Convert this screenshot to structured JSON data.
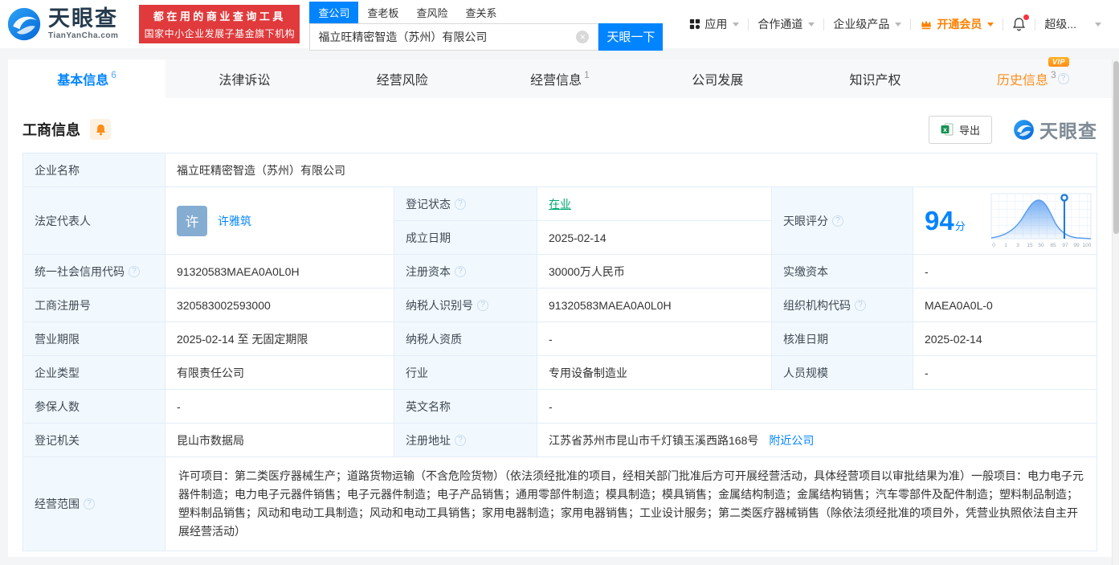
{
  "colors": {
    "brand_blue": "#0084ff",
    "vip_orange": "#ff8d1a",
    "status_green": "#00a972",
    "banner_red": "#e03a3c"
  },
  "header": {
    "logo_title": "天眼查",
    "logo_domain": "TianYanCha.com",
    "slogan_line1": "都在用的商业查询工具",
    "slogan_line2": "国家中小企业发展子基金旗下机构",
    "search_tabs": [
      {
        "label": "查公司"
      },
      {
        "label": "查老板"
      },
      {
        "label": "查风险"
      },
      {
        "label": "查关系"
      }
    ],
    "search_value": "福立旺精密智造（苏州）有限公司",
    "search_button": "天眼一下",
    "nav": {
      "apps": "应用",
      "cooperation": "合作通道",
      "enterprise": "企业级产品",
      "vip": "开通会员",
      "super": "超级..."
    }
  },
  "tabs": [
    {
      "label": "基本信息",
      "count": "6"
    },
    {
      "label": "法律诉讼",
      "count": ""
    },
    {
      "label": "经营风险",
      "count": ""
    },
    {
      "label": "经营信息",
      "count": "1"
    },
    {
      "label": "公司发展",
      "count": ""
    },
    {
      "label": "知识产权",
      "count": ""
    },
    {
      "label": "历史信息",
      "count": "3",
      "badge": "VIP"
    }
  ],
  "section": {
    "title": "工商信息",
    "export_label": "导出",
    "watermark": "天眼查"
  },
  "fields": {
    "company_name": {
      "label": "企业名称",
      "value": "福立旺精密智造（苏州）有限公司"
    },
    "legal_rep": {
      "label": "法定代表人",
      "avatar": "许",
      "value": "许雅筑"
    },
    "reg_status": {
      "label": "登记状态",
      "value": "在业"
    },
    "establish_date": {
      "label": "成立日期",
      "value": "2025-02-14"
    },
    "score": {
      "label": "天眼评分",
      "value": "94",
      "unit": "分"
    },
    "credit_code": {
      "label": "统一社会信用代码",
      "value": "91320583MAEA0A0L0H"
    },
    "reg_capital": {
      "label": "注册资本",
      "value": "30000万人民币"
    },
    "paid_capital": {
      "label": "实缴资本",
      "value": "-"
    },
    "reg_number": {
      "label": "工商注册号",
      "value": "320583002593000"
    },
    "taxpayer_id": {
      "label": "纳税人识别号",
      "value": "91320583MAEA0A0L0H"
    },
    "org_code": {
      "label": "组织机构代码",
      "value": "MAEA0A0L-0"
    },
    "business_term": {
      "label": "营业期限",
      "value": "2025-02-14 至 无固定期限"
    },
    "taxpayer_qual": {
      "label": "纳税人资质",
      "value": "-"
    },
    "approval_date": {
      "label": "核准日期",
      "value": "2025-02-14"
    },
    "company_type": {
      "label": "企业类型",
      "value": "有限责任公司"
    },
    "industry": {
      "label": "行业",
      "value": "专用设备制造业"
    },
    "staff_size": {
      "label": "人员规模",
      "value": "-"
    },
    "insured_count": {
      "label": "参保人数",
      "value": "-"
    },
    "english_name": {
      "label": "英文名称",
      "value": "-"
    },
    "reg_authority": {
      "label": "登记机关",
      "value": "昆山市数据局"
    },
    "reg_address": {
      "label": "注册地址",
      "value": "江苏省苏州市昆山市千灯镇玉溪西路168号",
      "link": "附近公司"
    },
    "business_scope": {
      "label": "经营范围",
      "value": "许可项目：第二类医疗器械生产；道路货物运输（不含危险货物）（依法须经批准的项目，经相关部门批准后方可开展经营活动，具体经营项目以审批结果为准）一般项目：电力电子元器件制造；电力电子元器件销售；电子元器件制造；电子产品销售；通用零部件制造；模具制造；模具销售；金属结构制造；金属结构销售；汽车零部件及配件制造；塑料制品制造；塑料制品销售；风动和电动工具制造；风动和电动工具销售；家用电器制造；家用电器销售；工业设计服务；第二类医疗器械销售（除依法须经批准的项目外，凭营业执照依法自主开展经营活动）"
    }
  },
  "chart_data": {
    "type": "area",
    "title": "天眼评分",
    "score": 94,
    "marker_value": 94,
    "xticks": [
      "0",
      "1",
      "3",
      "15",
      "50",
      "85",
      "97",
      "99",
      "100"
    ],
    "xlabel": "",
    "ylabel": "",
    "grid": true,
    "legend": false
  }
}
